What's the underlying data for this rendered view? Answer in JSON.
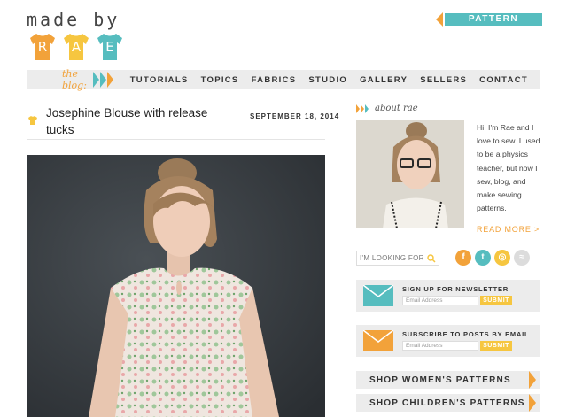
{
  "logo": {
    "text": "made by",
    "letters": [
      "R",
      "A",
      "E"
    ],
    "colors": [
      "#f2a23a",
      "#f6c640",
      "#56bdbf"
    ]
  },
  "pattern_shop": {
    "label": "PATTERN SHOP"
  },
  "nav": {
    "blog_tag": "the blog:",
    "items": [
      "TUTORIALS",
      "TOPICS",
      "FABRICS",
      "STUDIO",
      "GALLERY",
      "SELLERS",
      "CONTACT"
    ]
  },
  "post": {
    "title": "Josephine Blouse with release tucks",
    "date": "SEPTEMBER 18, 2014"
  },
  "sidebar": {
    "about_label": "about rae",
    "about_text": "Hi! I'm Rae and I love to sew. I used to be a physics teacher, but now I sew, blog, and make sewing patterns.",
    "read_more": "READ MORE >",
    "search_placeholder": "I'M LOOKING FOR",
    "social": [
      "f",
      "t",
      "◎",
      "≈"
    ],
    "newsletter": {
      "title": "SIGN UP FOR NEWSLETTER",
      "placeholder": "Email Address",
      "button": "SUBMIT"
    },
    "email_posts": {
      "title": "SUBSCRIBE TO POSTS BY EMAIL",
      "placeholder": "Email Address",
      "button": "SUBMIT"
    },
    "shop_women": "SHOP WOMEN'S PATTERNS",
    "shop_children": "SHOP CHILDREN'S PATTERNS"
  },
  "colors": {
    "orange": "#f2a23a",
    "yellow": "#f6c640",
    "teal": "#56bdbf",
    "gray": "#ececec"
  }
}
